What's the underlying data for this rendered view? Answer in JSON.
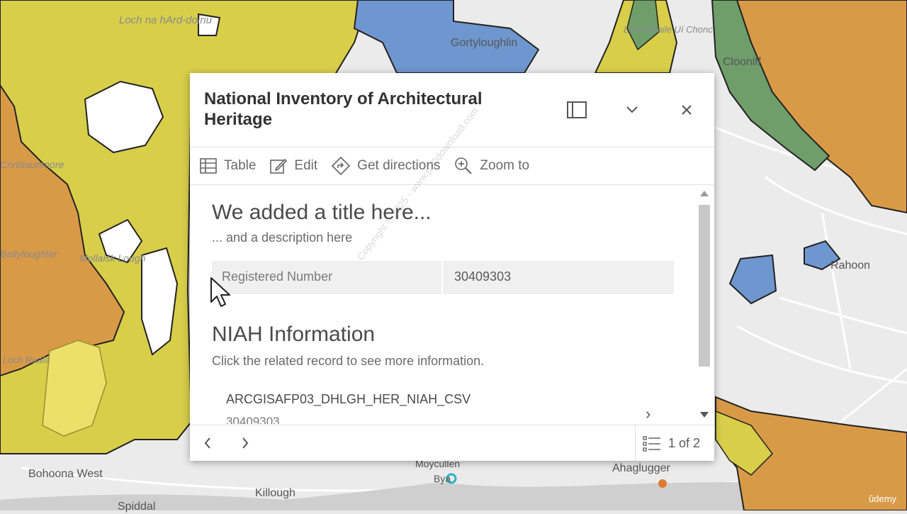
{
  "map": {
    "labels": [
      "Loch na hArd-doiriu",
      "Gortyloughlin",
      "Loch Bhaile Uí Chonc",
      "Clooniff",
      "Cnniliaunmore",
      "Rahoon",
      "Bohoona West",
      "Killough",
      "Ahaglugger",
      "Spiddal",
      "Loch Ruala",
      "Ballyloughter",
      "Mollaisk Lough",
      "Moycullen",
      "Bya"
    ]
  },
  "popup": {
    "title": "National Inventory of Architectural Heritage",
    "actions": {
      "table": "Table",
      "edit": "Edit",
      "directions": "Get directions",
      "zoom": "Zoom to"
    },
    "content": {
      "title": "We added a title here...",
      "description": "... and a description here",
      "field_label": "Registered Number",
      "field_value": "30409303",
      "section_title": "NIAH Information",
      "section_sub": "Click the related record to see more information.",
      "record_name": "ARCGISAFP03_DHLGH_HER_NIAH_CSV",
      "record_id": "30409303"
    },
    "pager": "1 of 2"
  },
  "watermark": "Copyright © 2025 - www.p30download.com",
  "brand": "ûdemy",
  "colors": {
    "yellow": "#d8ce4a",
    "light_yellow": "#ede06a",
    "orange": "#d99a48",
    "green": "#6f9e6a",
    "blue": "#6f97cf"
  }
}
